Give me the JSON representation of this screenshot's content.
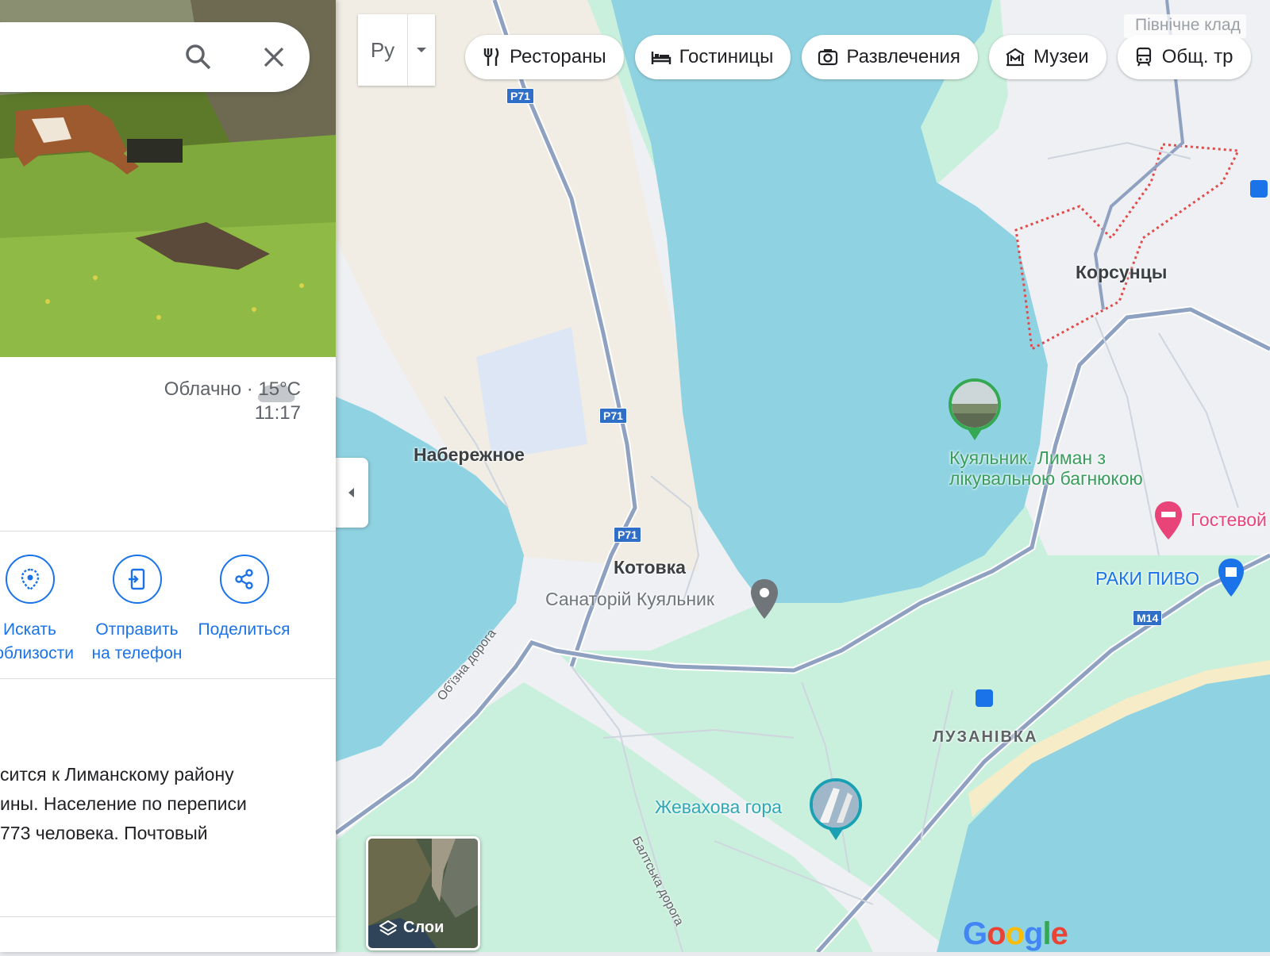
{
  "panel": {
    "weather": {
      "condition": "Облачно · 15°C",
      "time": "11:17",
      "icon": "cloud-icon"
    },
    "actions": [
      {
        "label_l1": "Искать",
        "label_l2": "поблизости",
        "icon": "nearby-icon"
      },
      {
        "label_l1": "Отправить",
        "label_l2": "на телефон",
        "icon": "send-to-phone-icon"
      },
      {
        "label_l1": "Поделиться",
        "label_l2": "",
        "icon": "share-icon"
      }
    ],
    "description": [
      "сится к Лиманскому району",
      "ины. Население по переписи",
      "773 человека. Почтовый"
    ]
  },
  "map": {
    "language_button": "Pу",
    "chips": [
      {
        "label": "Рестораны",
        "icon": "restaurant-icon"
      },
      {
        "label": "Гостиницы",
        "icon": "hotel-icon"
      },
      {
        "label": "Развлечения",
        "icon": "camera-icon"
      },
      {
        "label": "Музеи",
        "icon": "museum-icon"
      },
      {
        "label": "Общ. тр",
        "icon": "transit-icon"
      }
    ],
    "northern_label": "Північне клад",
    "places": {
      "naberezhnoe": "Набережное",
      "kotovka": "Котовка",
      "sanatorium": "Санаторій Куяльник",
      "korsuntsy": "Корсунцы",
      "kuyalnik_l1": "Куяльник. Лиман з",
      "kuyalnik_l2": "лікувальною багнюкою",
      "guest": "Гостевой",
      "raki": "РАКИ ПИВО",
      "luzanivka": "ЛУЗАНІВКА",
      "zhevakhova": "Жевахова гора"
    },
    "roads": {
      "r71": "P71",
      "m14": "M14",
      "bypass": "Об'їзна дорога",
      "balt": "Балтська дорога"
    },
    "layers_label": "Слои",
    "logo": "Google",
    "colors": {
      "water": "#8fd3e3",
      "land": "#eef0f3",
      "park": "#c9f0dc",
      "sand": "#f1ede4",
      "road": "#8fa1c0",
      "accent": "#1a73e8"
    }
  }
}
